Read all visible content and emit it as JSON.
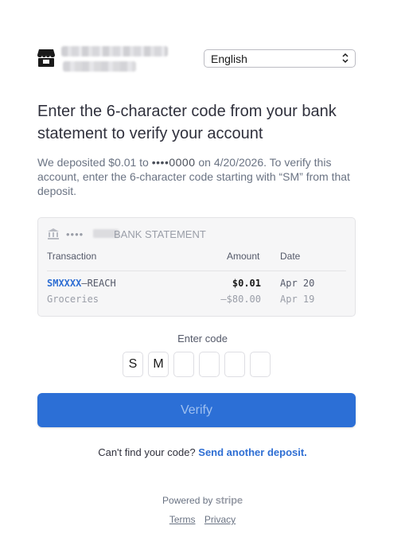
{
  "header": {
    "language": {
      "selected": "English"
    }
  },
  "title": "Enter the 6-character code from your bank statement to verify your account",
  "description": {
    "part1": "We deposited $0.01 to ",
    "masked_account": "••••0000",
    "part2": " on 4/20/2026. To verify this account, enter the 6-character code starting with “SM” from that deposit."
  },
  "statement": {
    "dots": "••••",
    "title": "BANK STATEMENT",
    "columns": {
      "transaction": "Transaction",
      "amount": "Amount",
      "date": "Date"
    },
    "rows": [
      {
        "code": "SMXXXX",
        "desc": "–REACH",
        "amount": "$0.01",
        "date": "Apr 20"
      },
      {
        "code": "",
        "desc": "Groceries",
        "amount": "–$80.00",
        "date": "Apr 19"
      }
    ]
  },
  "code_entry": {
    "label": "Enter code",
    "chars": [
      "S",
      "M",
      "",
      "",
      "",
      ""
    ]
  },
  "verify_button": {
    "label": "Verify"
  },
  "help": {
    "text": "Can't find your code?",
    "link": "Send another deposit."
  },
  "footer": {
    "powered_by": "Powered by",
    "brand": "stripe",
    "terms": "Terms",
    "privacy": "Privacy"
  },
  "colors": {
    "accent": "#2c6fd6",
    "link": "#2e6ed3",
    "code_highlight": "#2e6ed3"
  }
}
